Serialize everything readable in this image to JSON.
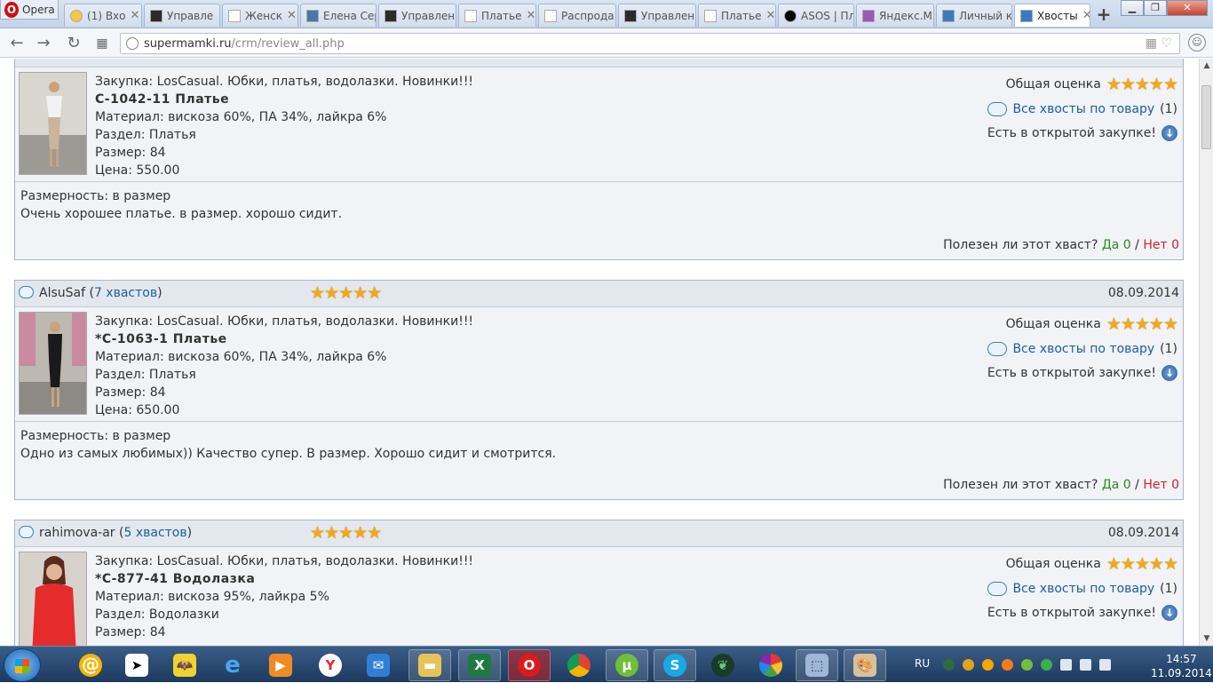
{
  "browser": {
    "name": "Opera",
    "tabs": [
      {
        "label": "(1) Вхо",
        "active": false
      },
      {
        "label": "Управле",
        "active": false
      },
      {
        "label": "Женск",
        "active": false
      },
      {
        "label": "Елена Сер",
        "active": false
      },
      {
        "label": "Управлен",
        "active": false
      },
      {
        "label": "Платье",
        "active": false
      },
      {
        "label": "Распрода",
        "active": false
      },
      {
        "label": "Управлен",
        "active": false
      },
      {
        "label": "Платье",
        "active": false
      },
      {
        "label": "ASOS | Пл",
        "active": false
      },
      {
        "label": "Яндекс.М",
        "active": false
      },
      {
        "label": "Личный к",
        "active": false
      },
      {
        "label": "Хвосты",
        "active": true
      }
    ],
    "new_tab": "+",
    "url_host": "supermamki.ru",
    "url_path": "/crm/review_all.php"
  },
  "reviews": [
    {
      "author": "",
      "count_label": "",
      "date": "",
      "purchase": "Закупка: LosCasual. Юбки, платья, водолазки. Новинки!!!",
      "product": "С-1042-11 Платье",
      "material": "Материал: вискоза 60%, ПА 34%, лайкра 6%",
      "section": "Раздел: Платья",
      "size": "Размер: 84",
      "price": "Цена: 550.00",
      "overall_label": "Общая оценка",
      "all_link": "Все хвосты по товару",
      "all_count": "(1)",
      "open_label": "Есть в открытой закупке!",
      "sizing": "Размерность: в размер",
      "text": "Очень хорошее платье. в размер. хорошо сидит.",
      "useful_q": "Полезен ли этот хваст?",
      "yes": "Да 0",
      "sep": "/",
      "no": "Нет 0"
    },
    {
      "author": "AlsuSaf",
      "count_label": "7 хвастов",
      "date": "08.09.2014",
      "purchase": "Закупка: LosCasual. Юбки, платья, водолазки. Новинки!!!",
      "product": "*С-1063-1 Платье",
      "material": "Материал: вискоза 60%, ПА 34%, лайкра 6%",
      "section": "Раздел: Платья",
      "size": "Размер: 84",
      "price": "Цена: 650.00",
      "overall_label": "Общая оценка",
      "all_link": "Все хвосты по товару",
      "all_count": "(1)",
      "open_label": "Есть в открытой закупке!",
      "sizing": "Размерность: в размер",
      "text": "Одно из самых любимых)) Качество супер. В размер. Хорошо сидит и смотрится.",
      "useful_q": "Полезен ли этот хваст?",
      "yes": "Да 0",
      "sep": "/",
      "no": "Нет 0"
    },
    {
      "author": "rahimova-ar",
      "count_label": "5 хвастов",
      "date": "08.09.2014",
      "purchase": "Закупка: LosCasual. Юбки, платья, водолазки. Новинки!!!",
      "product": "*С-877-41 Водолазка",
      "material": "Материал: вискоза 95%, лайкра 5%",
      "section": "Раздел: Водолазки",
      "size": "Размер: 84",
      "price": "",
      "overall_label": "Общая оценка",
      "all_link": "Все хвосты по товару",
      "all_count": "(1)",
      "open_label": "Есть в открытой закупке!"
    }
  ],
  "rating_stars": 5,
  "taskbar": {
    "lang": "RU",
    "time": "14:57",
    "date": "11.09.2014"
  },
  "colors": {
    "link": "#1a5f9e",
    "star": "#f2a81d",
    "yes": "#2b8a1f",
    "no": "#d62222"
  }
}
